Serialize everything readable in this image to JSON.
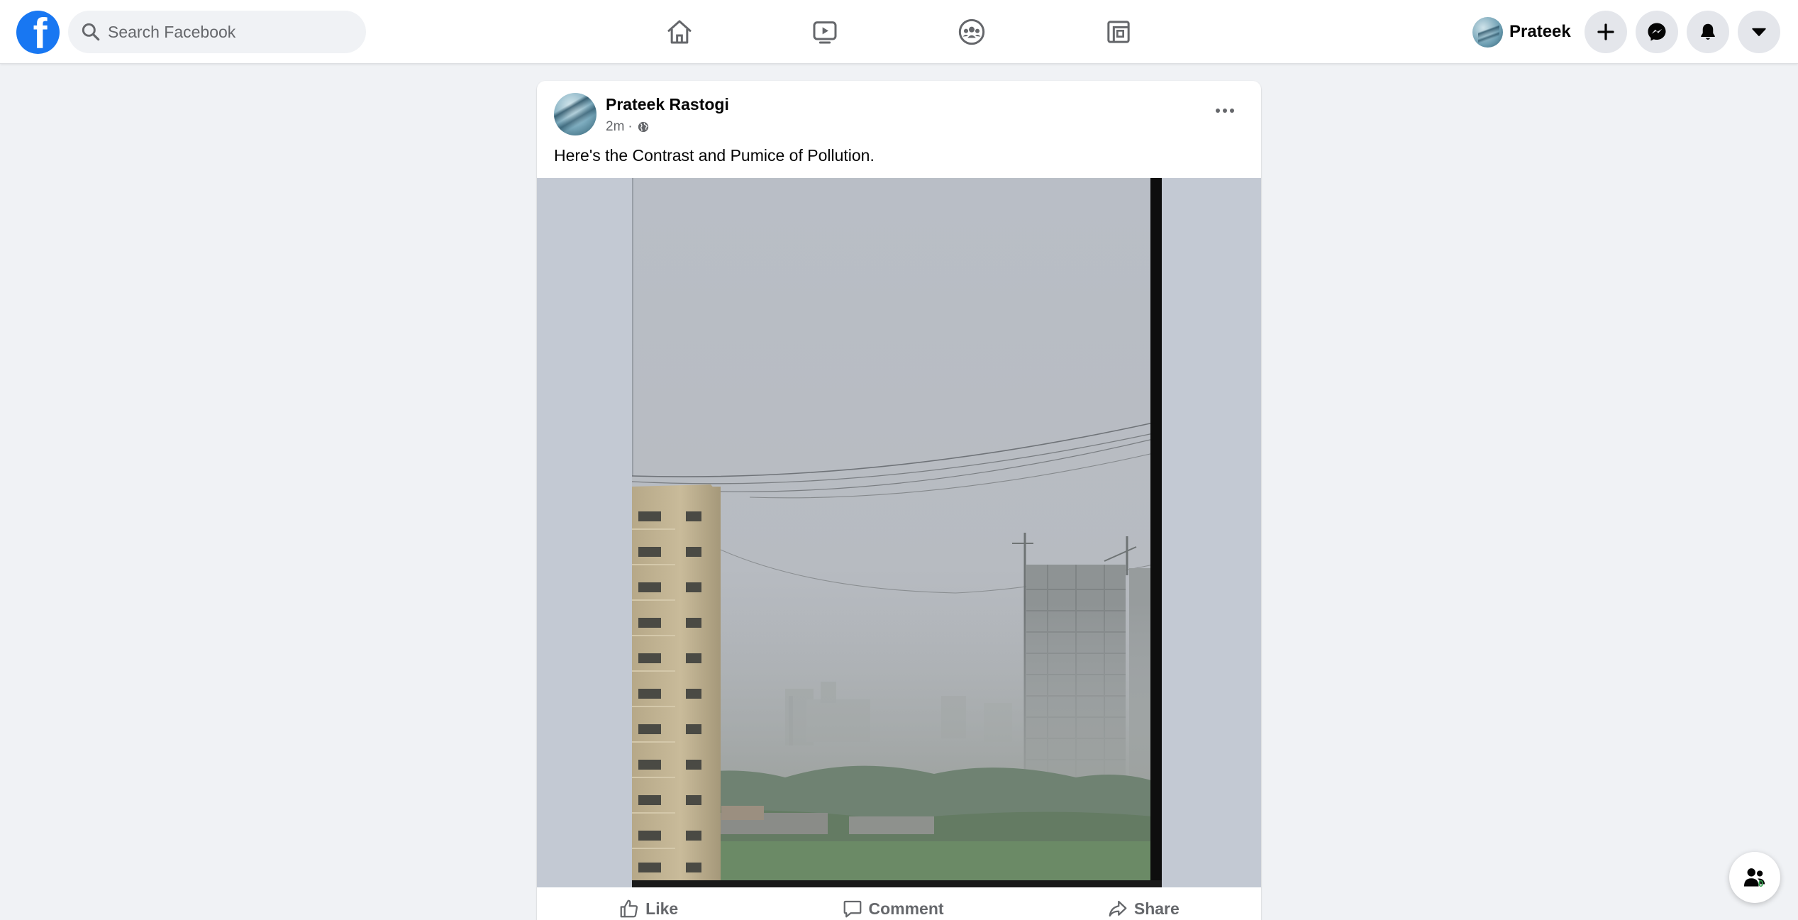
{
  "header": {
    "search": {
      "placeholder": "Search Facebook",
      "value": ""
    },
    "nav": [
      {
        "icon": "home-icon"
      },
      {
        "icon": "watch-icon"
      },
      {
        "icon": "groups-icon"
      },
      {
        "icon": "gaming-icon"
      }
    ],
    "profile": {
      "name": "Prateek"
    },
    "actions": [
      "create-plus-icon",
      "messenger-icon",
      "notifications-bell-icon",
      "account-caret-icon"
    ]
  },
  "post": {
    "author": "Prateek Rastogi",
    "time": "2m",
    "separator": "·",
    "privacy_icon": "globe-icon",
    "text": "Here's the Contrast and Pumice of Pollution.",
    "actions": {
      "like": "Like",
      "comment": "Comment",
      "share": "Share"
    }
  },
  "contacts_fab": {
    "count": "0"
  },
  "colors": {
    "brand": "#1877f2",
    "page_bg": "#f0f2f5",
    "secondary_text": "#65676b",
    "icon_dark": "#050505"
  }
}
